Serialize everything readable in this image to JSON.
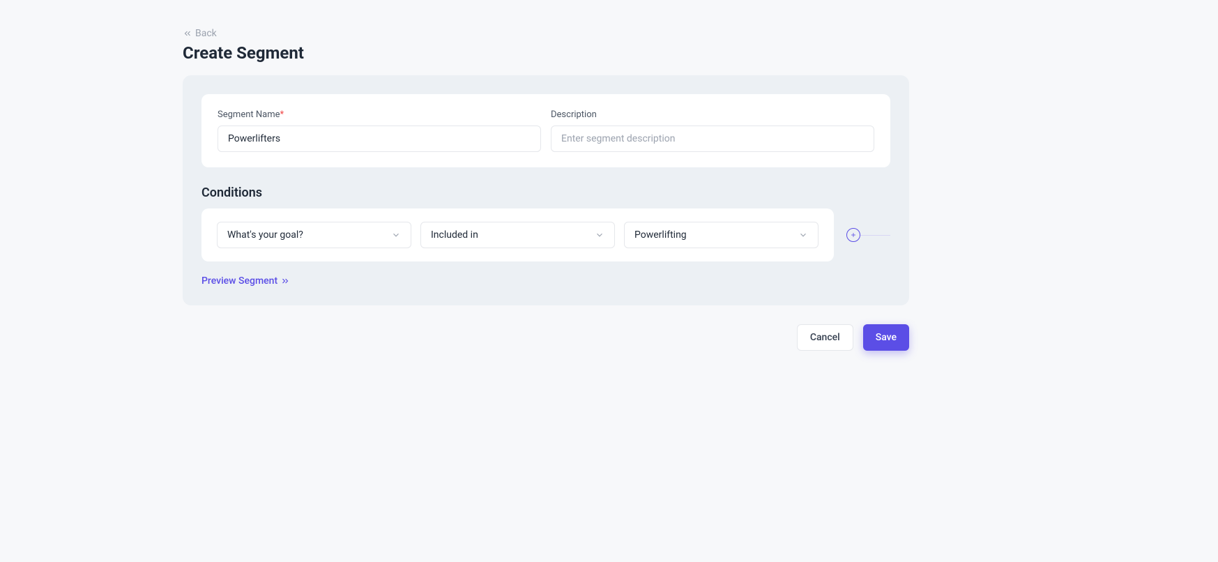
{
  "back_label": "Back",
  "page_title": "Create Segment",
  "form": {
    "name": {
      "label": "Segment Name",
      "required_mark": "*",
      "value": "Powerlifters"
    },
    "description": {
      "label": "Description",
      "placeholder": "Enter segment description",
      "value": ""
    }
  },
  "conditions": {
    "title": "Conditions",
    "rows": [
      {
        "field": "What's your goal?",
        "operator": "Included in",
        "value": "Powerlifting"
      }
    ]
  },
  "preview_label": "Preview Segment",
  "buttons": {
    "cancel": "Cancel",
    "save": "Save"
  }
}
